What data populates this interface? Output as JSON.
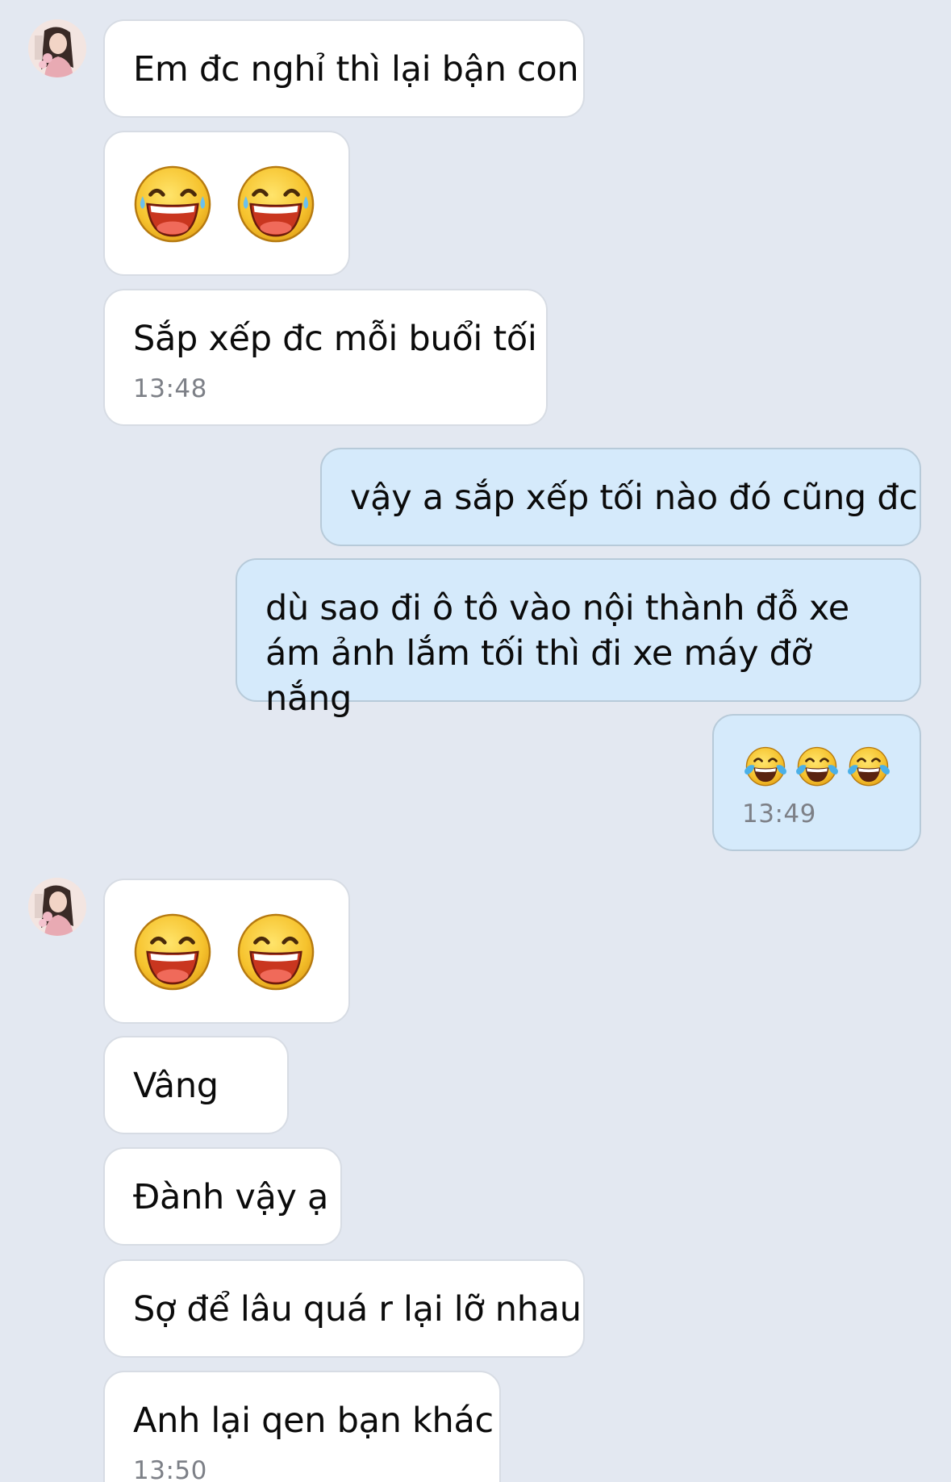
{
  "conversation": {
    "messages": [
      {
        "id": "m1",
        "sender": "contact",
        "text": "Em đc nghỉ thì lại bận con"
      },
      {
        "id": "m2",
        "sender": "contact",
        "emoji": [
          "grinning-face-with-sweat",
          "grinning-face-with-sweat"
        ]
      },
      {
        "id": "m3",
        "sender": "contact",
        "text": "Sắp xếp đc mỗi buổi tối",
        "time": "13:48"
      },
      {
        "id": "m4",
        "sender": "me",
        "text": "vậy a sắp xếp tối nào đó cũng đc"
      },
      {
        "id": "m5",
        "sender": "me",
        "text": "dù sao đi ô tô vào nội thành đỗ xe ám ảnh lắm tối thì đi xe máy đỡ nắng"
      },
      {
        "id": "m6",
        "sender": "me",
        "emoji": [
          "face-with-tears-of-joy",
          "face-with-tears-of-joy",
          "face-with-tears-of-joy"
        ],
        "time": "13:49"
      },
      {
        "id": "m7",
        "sender": "contact",
        "emoji": [
          "grinning-face",
          "grinning-face"
        ]
      },
      {
        "id": "m8",
        "sender": "contact",
        "text": "Vâng"
      },
      {
        "id": "m9",
        "sender": "contact",
        "text": "Đành vậy ạ"
      },
      {
        "id": "m10",
        "sender": "contact",
        "text": "Sợ để lâu quá r lại lỡ nhau"
      },
      {
        "id": "m11",
        "sender": "contact",
        "text": "Anh lại qen bạn khác",
        "time": "13:50"
      }
    ]
  },
  "colors": {
    "background": "#e3e8f1",
    "incoming_bubble": "#ffffff",
    "outgoing_bubble": "#d5eafb",
    "timestamp": "#7d8087"
  }
}
